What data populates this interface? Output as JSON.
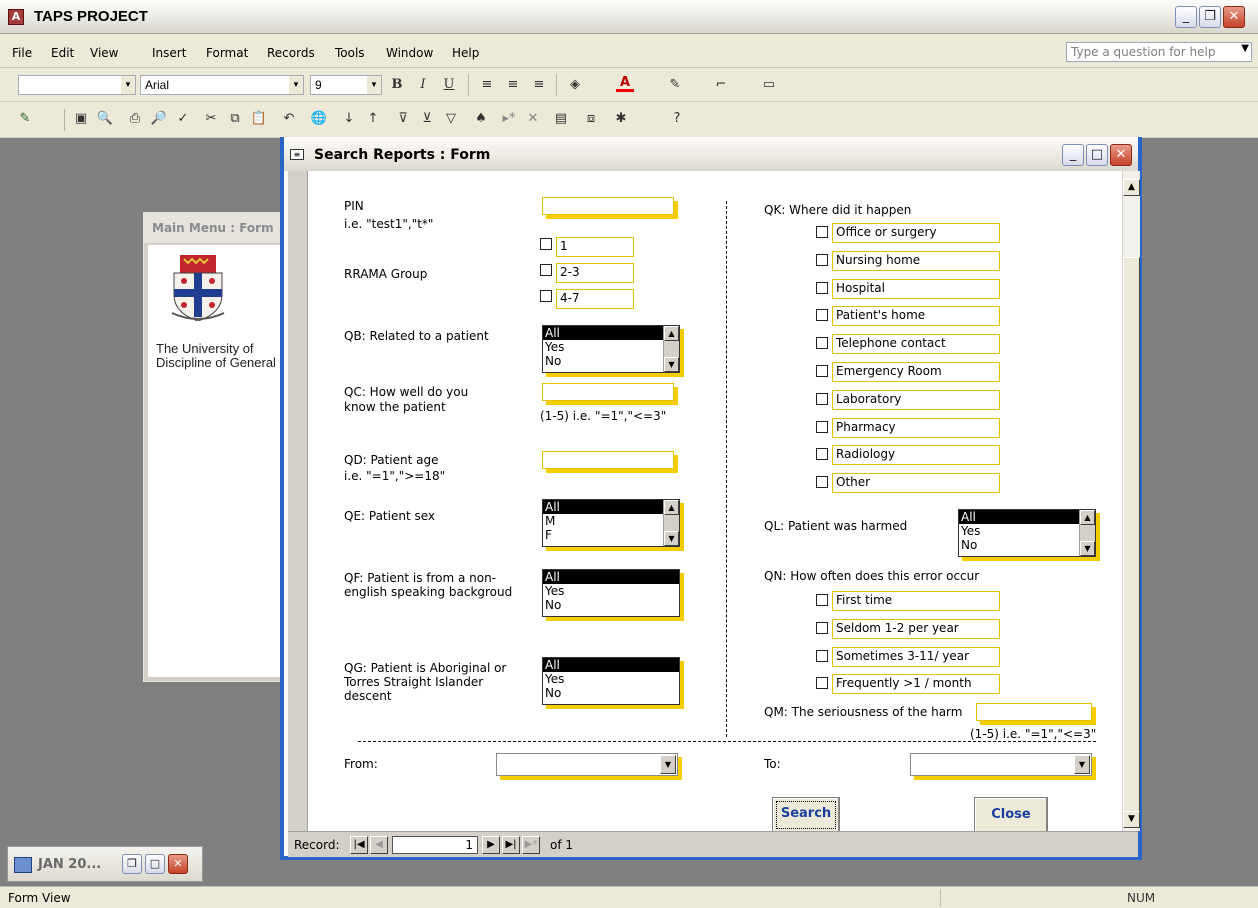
{
  "app": {
    "title": "TAPS PROJECT",
    "help_placeholder": "Type a question for help"
  },
  "menu": [
    "File",
    "Edit",
    "View",
    "Insert",
    "Format",
    "Records",
    "Tools",
    "Window",
    "Help"
  ],
  "toolbar": {
    "font_name": "Arial",
    "font_size": "9",
    "bold": "B",
    "italic": "I",
    "underline": "U"
  },
  "main_menu": {
    "title": "Main Menu : Form",
    "univ_line1": "The University of",
    "univ_line2": "Discipline of General"
  },
  "search_form": {
    "title": "Search Reports : Form",
    "pin_label": "PIN",
    "pin_hint": "i.e. \"test1\",\"t*\"",
    "rrama_label": "RRAMA Group",
    "rrama_options": [
      "1",
      "2-3",
      "4-7"
    ],
    "qb_label": "QB: Related to a patient",
    "qb_options": [
      "All",
      "Yes",
      "No"
    ],
    "qc_label_1": "QC: How well do you",
    "qc_label_2": "know the patient",
    "qc_hint": "(1-5) i.e. \"=1\",\"<=3\"",
    "qd_label": "QD: Patient age",
    "qd_hint": " i.e. \"=1\",\">=18\"",
    "qe_label": "QE: Patient sex",
    "qe_options": [
      "All",
      "M",
      "F"
    ],
    "qf_label_1": "QF: Patient is from a non-",
    "qf_label_2": "english speaking backgroud",
    "qf_options": [
      "All",
      "Yes",
      "No"
    ],
    "qg_label_1": "QG: Patient is Aboriginal or",
    "qg_label_2": "Torres Straight Islander",
    "qg_label_3": "descent",
    "qg_options": [
      "All",
      "Yes",
      "No"
    ],
    "qk_label": "QK: Where did it happen",
    "qk_options": [
      "Office or surgery",
      "Nursing home",
      "Hospital",
      "Patient's home",
      "Telephone contact",
      "Emergency Room",
      "Laboratory",
      "Pharmacy",
      "Radiology",
      "Other"
    ],
    "ql_label": "QL: Patient was harmed",
    "ql_options": [
      "All",
      "Yes",
      "No"
    ],
    "qn_label": "QN: How often does this error occur",
    "qn_options": [
      "First time",
      "Seldom 1-2 per year",
      "Sometimes 3-11/ year",
      "Frequently >1 / month"
    ],
    "qm_label": "QM: The seriousness of the harm",
    "qm_hint": "(1-5) i.e. \"=1\",\"<=3\"",
    "from_label": "From:",
    "to_label": "To:",
    "search_btn": "Search",
    "close_btn": "Close"
  },
  "record_nav": {
    "label": "Record:",
    "current": "1",
    "of_text": "of 1"
  },
  "minimized": {
    "title": "JAN 20..."
  },
  "status": {
    "left": "Form View",
    "right": "NUM"
  }
}
